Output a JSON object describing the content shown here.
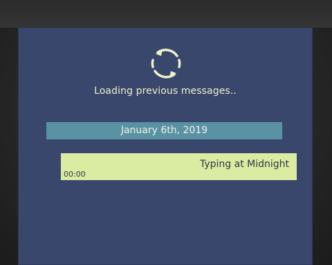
{
  "loader": {
    "icon": "refresh-icon",
    "color": "#eef0c8",
    "text": "Loading previous messages.."
  },
  "date_separator": {
    "label": "January 6th, 2019",
    "color": "#5b92a3"
  },
  "messages": [
    {
      "title": "Typing at Midnight",
      "time": "00:00",
      "color": "#d9eca1"
    }
  ]
}
